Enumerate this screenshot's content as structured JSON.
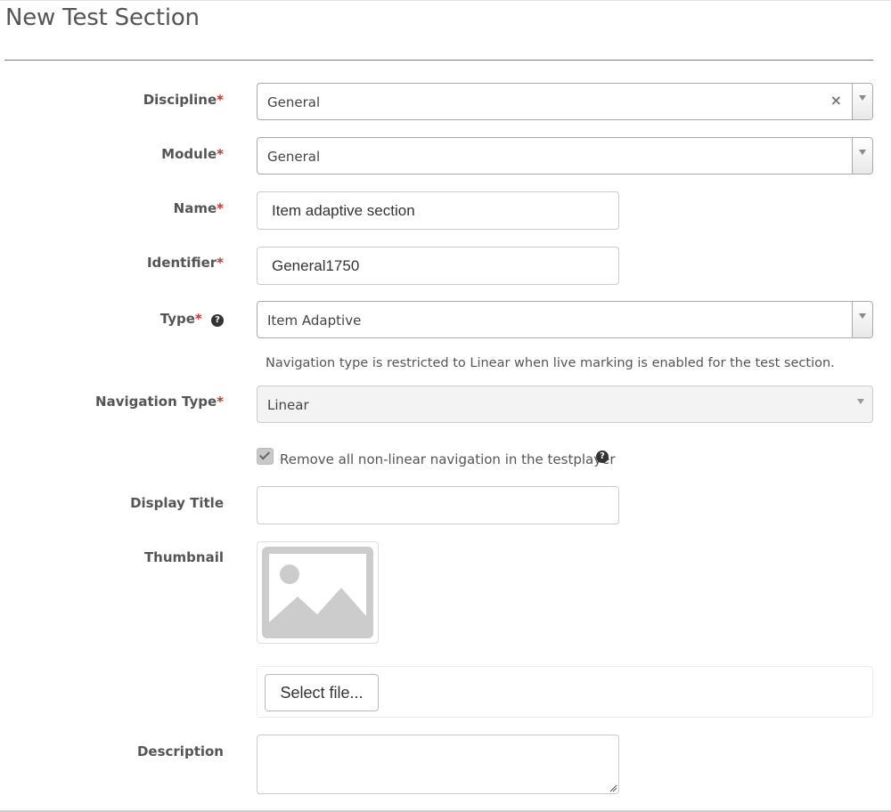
{
  "page": {
    "title": "New Test Section"
  },
  "form": {
    "discipline": {
      "label": "Discipline",
      "required_mark": "*",
      "value": "General",
      "clear_glyph": "×"
    },
    "module": {
      "label": "Module",
      "required_mark": "*",
      "value": "General"
    },
    "name": {
      "label": "Name",
      "required_mark": "*",
      "value": "Item adaptive section"
    },
    "identifier": {
      "label": "Identifier",
      "required_mark": "*",
      "value": "General1750"
    },
    "type": {
      "label": "Type",
      "required_mark": "*",
      "value": "Item Adaptive",
      "help_glyph": "?"
    },
    "navigation_hint": "Navigation type is restricted to Linear when live marking is enabled for the test section.",
    "navigation_type": {
      "label": "Navigation Type",
      "required_mark": "*",
      "value": "Linear",
      "disabled": true
    },
    "remove_nonlinear": {
      "label": "Remove all non-linear navigation in the testplayer",
      "checked": true,
      "disabled": true,
      "help_glyph": "?"
    },
    "display_title": {
      "label": "Display Title",
      "value": ""
    },
    "thumbnail": {
      "label": "Thumbnail",
      "icon": "image-placeholder-icon"
    },
    "file_picker": {
      "button_label": "Select file..."
    },
    "description": {
      "label": "Description",
      "value": ""
    }
  },
  "colors": {
    "required": "#c0392b",
    "label": "#555555",
    "border": "#aaaaaa",
    "disabled_bg": "#f3f3f3",
    "placeholder_image": "#cccccc"
  }
}
